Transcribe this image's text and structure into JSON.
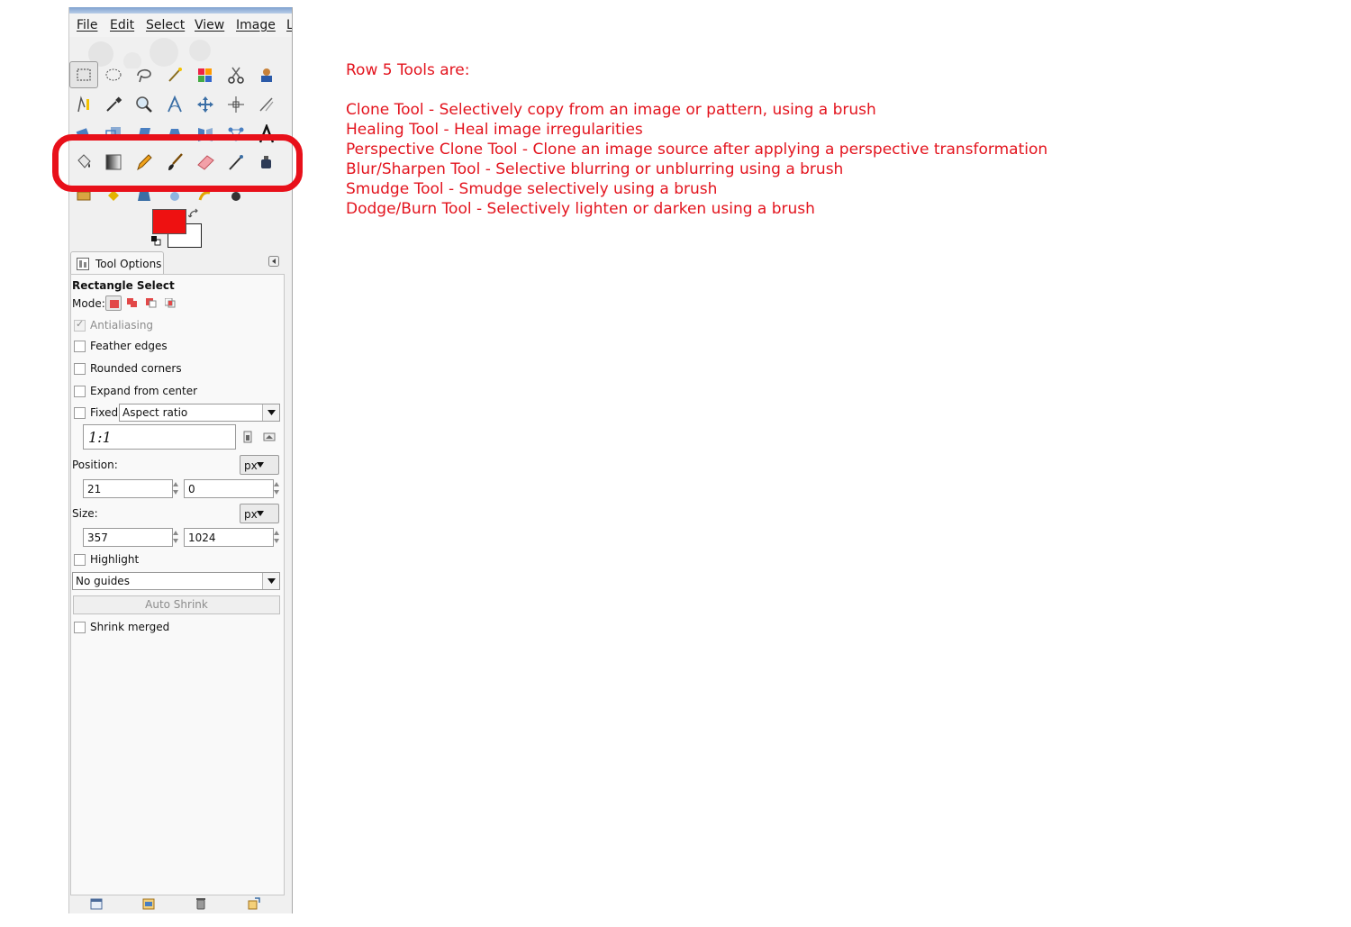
{
  "menubar": {
    "items": [
      "File",
      "Edit",
      "Select",
      "View",
      "Image",
      "L"
    ]
  },
  "toolbox": {
    "rows": [
      [
        "rect-select-icon",
        "ellipse-select-icon",
        "lasso-icon",
        "magic-wand-icon",
        "select-by-color-icon",
        "scissors-icon",
        "foreground-select-icon"
      ],
      [
        "paths-icon",
        "color-picker-icon",
        "zoom-icon",
        "measure-icon",
        "move-icon",
        "align-icon",
        "crop-icon"
      ],
      [
        "rotate-icon",
        "scale-icon",
        "shear-icon",
        "perspective-icon",
        "flip-icon",
        "cage-icon",
        "text-icon"
      ],
      [
        "bucket-fill-icon",
        "blend-icon",
        "pencil-icon",
        "paintbrush-icon",
        "eraser-icon",
        "airbrush-icon",
        "ink-icon"
      ],
      [
        "clone-icon",
        "heal-icon",
        "perspective-clone-icon",
        "blur-sharpen-icon",
        "smudge-icon",
        "dodge-burn-icon"
      ]
    ],
    "foreground_color": "#ee1111",
    "background_color": "#ffffff",
    "highlight_color": "#e8101a"
  },
  "tool_options": {
    "tab_label": "Tool Options",
    "title": "Rectangle Select",
    "mode_label": "Mode:",
    "antialiasing": {
      "label": "Antialiasing",
      "checked": true,
      "disabled": true
    },
    "feather_edges": {
      "label": "Feather edges",
      "checked": false
    },
    "rounded_corners": {
      "label": "Rounded corners",
      "checked": false
    },
    "expand_from_center": {
      "label": "Expand from center",
      "checked": false
    },
    "fixed": {
      "label": "Fixed:",
      "checked": false,
      "selected": "Aspect ratio"
    },
    "ratio_value": "1:1",
    "position": {
      "label": "Position:",
      "unit": "px",
      "x": "21",
      "y": "0"
    },
    "size": {
      "label": "Size:",
      "unit": "px",
      "w": "357",
      "h": "1024"
    },
    "highlight": {
      "label": "Highlight",
      "checked": false
    },
    "guides": "No guides",
    "auto_shrink": "Auto Shrink",
    "shrink_merged": {
      "label": "Shrink merged",
      "checked": false
    }
  },
  "annotation": {
    "heading": "Row 5 Tools are:",
    "lines": [
      "Clone Tool - Selectively copy from an image or pattern, using a brush",
      "Healing Tool - Heal image irregularities",
      "Perspective Clone Tool - Clone an image source after applying a perspective transformation",
      "Blur/Sharpen Tool - Selective blurring or unblurring using a brush",
      "Smudge Tool - Smudge selectively using a brush",
      "Dodge/Burn Tool - Selectively lighten or darken using a brush"
    ],
    "color": "#e3141e"
  }
}
